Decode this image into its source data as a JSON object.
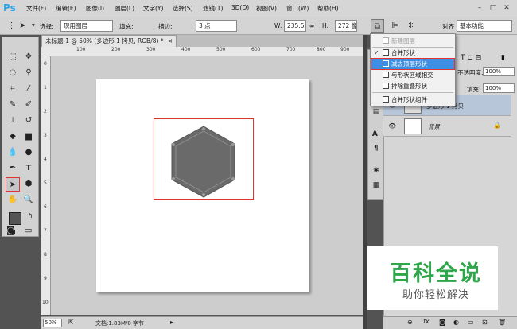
{
  "app": {
    "logo": "Ps"
  },
  "menu": [
    "文件(F)",
    "编辑(E)",
    "图像(I)",
    "图层(L)",
    "文字(Y)",
    "选择(S)",
    "滤镜(T)",
    "3D(D)",
    "视图(V)",
    "窗口(W)",
    "帮助(H)"
  ],
  "options": {
    "select_label": "选择:",
    "select_value": "现用图层",
    "fill_label": "填充:",
    "stroke_label": "描边:",
    "stroke_width": "3 点",
    "w_label": "W:",
    "w_value": "235.56",
    "h_label": "H:",
    "h_value": "272 像",
    "align_label": "对齐",
    "workspace": "基本功能"
  },
  "document": {
    "tab_title": "未标题-1 @ 50% (多边形 1 拷贝, RGB/8) *",
    "ruler_ticks": [
      "100",
      "200",
      "300",
      "400",
      "500",
      "600",
      "700",
      "800",
      "900"
    ],
    "left_ruler_ticks": [
      "0",
      "1",
      "2",
      "3",
      "4",
      "5",
      "6",
      "7",
      "8",
      "9",
      "10"
    ]
  },
  "status": {
    "zoom": "50%",
    "doc_info": "文档:1.83M/0 字节"
  },
  "dropdown": {
    "items": [
      {
        "label": "新建图层",
        "state": "disabled"
      },
      {
        "label": "合并形状",
        "state": "checked"
      },
      {
        "label": "减去顶层形状",
        "state": "highlighted"
      },
      {
        "label": "与形状区域相交",
        "state": "normal"
      },
      {
        "label": "排除重叠形状",
        "state": "normal"
      },
      {
        "label": "合并形状组件",
        "state": "normal"
      }
    ]
  },
  "layers": {
    "opacity_label": "不透明度:",
    "opacity_value": "100%",
    "fill_label": "填充:",
    "fill_value": "100%",
    "rows": [
      {
        "name": "多边形 1 拷贝",
        "selected": true
      },
      {
        "name": "背景",
        "selected": false
      }
    ]
  },
  "watermark": {
    "title": "百科全说",
    "subtitle": "助你轻松解决"
  },
  "colors": {
    "accent": "#3d8fe6",
    "selection": "#e0352f",
    "hexagon_fill": "#6a6a6a",
    "watermark_green": "#2ea64a"
  }
}
